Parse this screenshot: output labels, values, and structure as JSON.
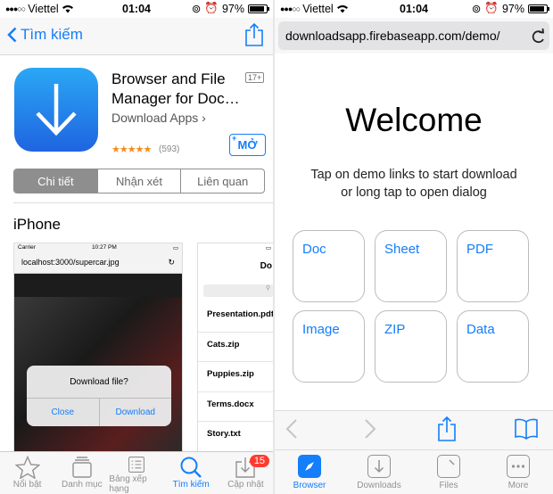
{
  "left": {
    "status": {
      "carrier": "Viettel",
      "time": "01:04",
      "battery": "97%"
    },
    "nav": {
      "back_label": "Tìm kiếm"
    },
    "app": {
      "title": "Browser and File Manager for Doc…",
      "developer": "Download Apps",
      "age_rating": "17+",
      "stars": "★★★★★",
      "rating_count": "(593)",
      "get_label": "MỞ",
      "get_plus": "+"
    },
    "segments": [
      "Chi tiết",
      "Nhận xét",
      "Liên quan"
    ],
    "platform": "iPhone",
    "shot1": {
      "carrier": "Carrier",
      "time": "10:27 PM",
      "url": "localhost:3000/supercar.jpg",
      "dialog_title": "Download file?",
      "close": "Close",
      "download": "Download"
    },
    "shot2": {
      "header": "Do",
      "items": [
        "Presentation.pdf",
        "Cats.zip",
        "Puppies.zip",
        "Terms.docx",
        "Story.txt"
      ]
    },
    "tabs": [
      {
        "label": "Nổi bật",
        "icon": "star-icon"
      },
      {
        "label": "Danh mục",
        "icon": "categories-icon"
      },
      {
        "label": "Bảng xếp hạng",
        "icon": "list-icon"
      },
      {
        "label": "Tìm kiếm",
        "icon": "search-icon"
      },
      {
        "label": "Cập nhật",
        "icon": "download-icon",
        "badge": "15"
      }
    ]
  },
  "right": {
    "status": {
      "carrier": "Viettel",
      "time": "01:04",
      "battery": "97%"
    },
    "url": "downloadsapp.firebaseapp.com/demo/",
    "welcome": "Welcome",
    "subtitle_line1": "Tap on demo links to start download",
    "subtitle_line2": "or long tap to open dialog",
    "tiles": [
      "Doc",
      "Sheet",
      "PDF",
      "Image",
      "ZIP",
      "Data"
    ],
    "tabs": [
      {
        "label": "Browser",
        "icon": "compass-icon"
      },
      {
        "label": "Downloads",
        "icon": "download-icon"
      },
      {
        "label": "Files",
        "icon": "file-icon"
      },
      {
        "label": "More",
        "icon": "more-icon"
      }
    ]
  },
  "colors": {
    "accent": "#147efb",
    "badge": "#ff3b30",
    "star": "#f48c18"
  }
}
